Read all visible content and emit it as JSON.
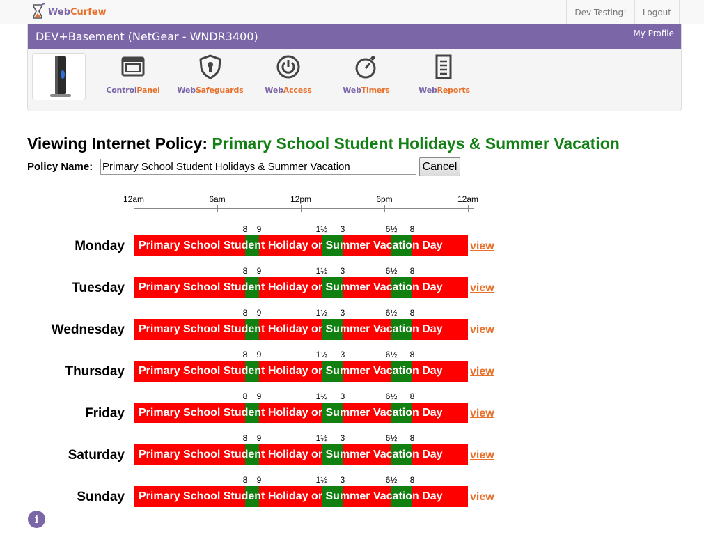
{
  "brand": {
    "web": "Web",
    "curfew": "Curfew"
  },
  "topnav": {
    "user": "Dev Testing!",
    "logout": "Logout"
  },
  "device": {
    "title": "DEV+Basement (NetGear - WNDR3400)",
    "my_profile": "My Profile"
  },
  "nav": [
    {
      "part1": "Control",
      "part2": "Panel",
      "icon": "control-panel-icon"
    },
    {
      "part1": "Web",
      "part2": "Safeguards",
      "icon": "shield-icon"
    },
    {
      "part1": "Web",
      "part2": "Access",
      "icon": "power-icon"
    },
    {
      "part1": "Web",
      "part2": "Timers",
      "icon": "stopwatch-icon"
    },
    {
      "part1": "Web",
      "part2": "Reports",
      "icon": "report-icon"
    }
  ],
  "policy": {
    "heading_prefix": "Viewing Internet Policy:",
    "name": "Primary School Student Holidays & Summer Vacation",
    "name_label": "Policy Name:",
    "input_value": "Primary School Student Holidays & Summer Vacation",
    "cancel": "Cancel"
  },
  "scale": {
    "labels": [
      "12am",
      "6am",
      "12pm",
      "6pm",
      "12am"
    ],
    "hours": [
      0,
      6,
      12,
      18,
      24
    ]
  },
  "schedule": {
    "bar_label": "Primary School Student Holiday or Summer Vacation Day",
    "view_label": "view",
    "colors": {
      "blocked": "#ff0000",
      "allowed": "#118011"
    },
    "allowed_windows": [
      {
        "start": 8,
        "end": 9,
        "start_label": "8",
        "end_label": "9"
      },
      {
        "start": 13.5,
        "end": 15,
        "start_label": "1½",
        "end_label": "3"
      },
      {
        "start": 18.5,
        "end": 20,
        "start_label": "6½",
        "end_label": "8"
      }
    ],
    "days": [
      "Monday",
      "Tuesday",
      "Wednesday",
      "Thursday",
      "Friday",
      "Saturday",
      "Sunday"
    ]
  },
  "info": {
    "label": "i"
  }
}
